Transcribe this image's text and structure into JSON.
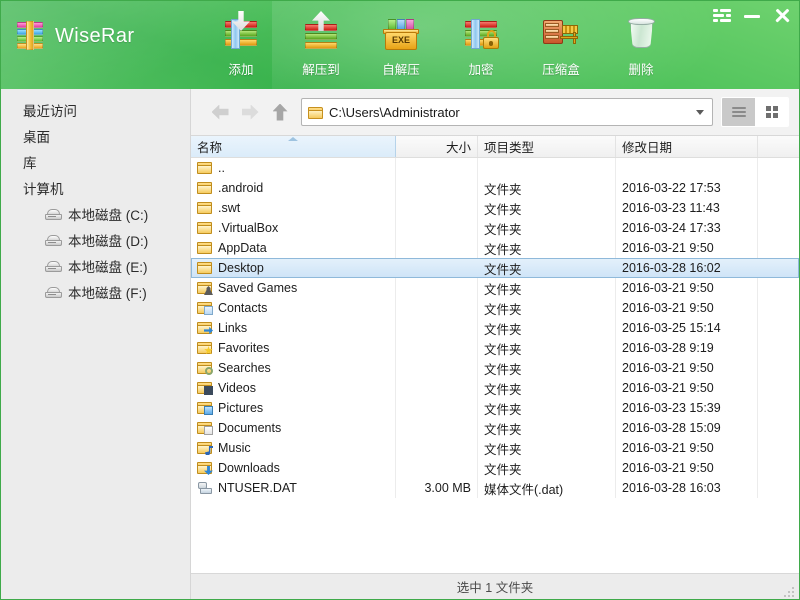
{
  "window": {
    "app_title": "WiseRar",
    "logo_icon": "archive-books-icon",
    "controls": {
      "menu_label": "menu-icon",
      "minimize_label": "minimize-icon",
      "close_label": "close-icon"
    }
  },
  "toolbar": {
    "items": [
      {
        "label": "添加",
        "icon": "add-to-archive-icon"
      },
      {
        "label": "解压到",
        "icon": "extract-to-icon"
      },
      {
        "label": "自解压",
        "icon": "self-extract-exe-icon"
      },
      {
        "label": "加密",
        "icon": "encrypt-lock-icon"
      },
      {
        "label": "压缩盒",
        "icon": "compress-box-icon"
      },
      {
        "label": "删除",
        "icon": "delete-trash-icon"
      }
    ]
  },
  "sidebar": {
    "items": [
      {
        "label": "最近访问",
        "icon": "",
        "child": false
      },
      {
        "label": "桌面",
        "icon": "",
        "child": false
      },
      {
        "label": "库",
        "icon": "",
        "child": false
      },
      {
        "label": "计算机",
        "icon": "",
        "child": false
      },
      {
        "label": "本地磁盘 (C:)",
        "icon": "drive-icon",
        "child": true
      },
      {
        "label": "本地磁盘 (D:)",
        "icon": "drive-icon",
        "child": true
      },
      {
        "label": "本地磁盘 (E:)",
        "icon": "drive-icon",
        "child": true
      },
      {
        "label": "本地磁盘 (F:)",
        "icon": "drive-icon",
        "child": true
      }
    ]
  },
  "nav": {
    "back_icon": "back-arrow-icon",
    "forward_icon": "forward-arrow-icon",
    "up_icon": "up-arrow-icon",
    "path_value": "C:\\Users\\Administrator",
    "path_placeholder": "C:\\",
    "dropdown_icon": "chevron-down-icon",
    "view_list_icon": "list-view-icon",
    "view_tile_icon": "tile-view-icon",
    "active_view": "list"
  },
  "table": {
    "columns": [
      {
        "key": "name",
        "label": "名称",
        "sorted": true,
        "align": "left"
      },
      {
        "key": "size",
        "label": "大小",
        "sorted": false,
        "align": "right"
      },
      {
        "key": "type",
        "label": "项目类型",
        "sorted": false,
        "align": "left"
      },
      {
        "key": "date",
        "label": "修改日期",
        "sorted": false,
        "align": "left"
      },
      {
        "key": "rest",
        "label": "",
        "sorted": false,
        "align": "left"
      }
    ],
    "rows": [
      {
        "name": "..",
        "size": "",
        "type": "",
        "date": "",
        "icon": "folder-icon",
        "overlay": "",
        "selected": false
      },
      {
        "name": ".android",
        "size": "",
        "type": "文件夹",
        "date": "2016-03-22 17:53",
        "icon": "folder-icon",
        "overlay": "",
        "selected": false
      },
      {
        "name": ".swt",
        "size": "",
        "type": "文件夹",
        "date": "2016-03-23 11:43",
        "icon": "folder-icon",
        "overlay": "",
        "selected": false
      },
      {
        "name": ".VirtualBox",
        "size": "",
        "type": "文件夹",
        "date": "2016-03-24 17:33",
        "icon": "folder-icon",
        "overlay": "",
        "selected": false
      },
      {
        "name": "AppData",
        "size": "",
        "type": "文件夹",
        "date": "2016-03-21 9:50",
        "icon": "folder-icon",
        "overlay": "",
        "selected": false
      },
      {
        "name": "Desktop",
        "size": "",
        "type": "文件夹",
        "date": "2016-03-28 16:02",
        "icon": "folder-icon",
        "overlay": "",
        "selected": true
      },
      {
        "name": "Saved Games",
        "size": "",
        "type": "文件夹",
        "date": "2016-03-21 9:50",
        "icon": "folder-saved-games-icon",
        "overlay": "person",
        "selected": false
      },
      {
        "name": "Contacts",
        "size": "",
        "type": "文件夹",
        "date": "2016-03-21 9:50",
        "icon": "folder-contacts-icon",
        "overlay": "card",
        "selected": false
      },
      {
        "name": "Links",
        "size": "",
        "type": "文件夹",
        "date": "2016-03-25 15:14",
        "icon": "folder-links-icon",
        "overlay": "arrow",
        "selected": false
      },
      {
        "name": "Favorites",
        "size": "",
        "type": "文件夹",
        "date": "2016-03-28 9:19",
        "icon": "folder-favorites-icon",
        "overlay": "star",
        "selected": false
      },
      {
        "name": "Searches",
        "size": "",
        "type": "文件夹",
        "date": "2016-03-21 9:50",
        "icon": "folder-searches-icon",
        "overlay": "mag",
        "selected": false
      },
      {
        "name": "Videos",
        "size": "",
        "type": "文件夹",
        "date": "2016-03-21 9:50",
        "icon": "folder-videos-icon",
        "overlay": "film",
        "selected": false
      },
      {
        "name": "Pictures",
        "size": "",
        "type": "文件夹",
        "date": "2016-03-23 15:39",
        "icon": "folder-pictures-icon",
        "overlay": "pic",
        "selected": false
      },
      {
        "name": "Documents",
        "size": "",
        "type": "文件夹",
        "date": "2016-03-28 15:09",
        "icon": "folder-documents-icon",
        "overlay": "doc",
        "selected": false
      },
      {
        "name": "Music",
        "size": "",
        "type": "文件夹",
        "date": "2016-03-21 9:50",
        "icon": "folder-music-icon",
        "overlay": "music",
        "selected": false
      },
      {
        "name": "Downloads",
        "size": "",
        "type": "文件夹",
        "date": "2016-03-21 9:50",
        "icon": "folder-downloads-icon",
        "overlay": "dl",
        "selected": false
      },
      {
        "name": "NTUSER.DAT",
        "size": "3.00 MB",
        "type": "媒体文件(.dat)",
        "date": "2016-03-28 16:03",
        "icon": "dat-file-icon",
        "overlay": "",
        "selected": false
      }
    ]
  },
  "status": {
    "text": "选中 1 文件夹",
    "grip_icon": "resize-grip-icon"
  },
  "colors": {
    "brand_green": "#3fbb53",
    "selection_blue": "#cfe4f7",
    "header_sorted": "#dbecfa"
  }
}
